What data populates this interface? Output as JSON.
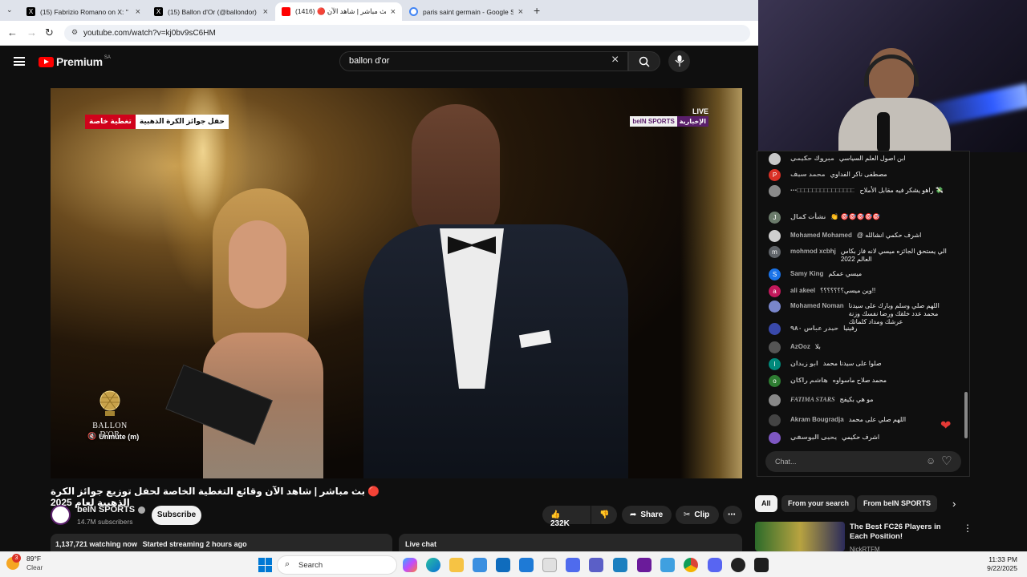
{
  "browser": {
    "tabs": [
      {
        "label": "(15) Fabrizio Romano on X: \"",
        "icon": "x-logo-icon",
        "active": false
      },
      {
        "label": "(15) Ballon d'Or (@ballondor) /",
        "icon": "x-logo-icon",
        "active": false
      },
      {
        "label": "بث مباشر | شاهد الآن 🔴 (1416)",
        "icon": "youtube-icon",
        "active": true
      },
      {
        "label": "paris saint germain - Google Se",
        "icon": "google-icon",
        "active": false
      }
    ],
    "url": "youtube.com/watch?v=kj0bv9sC6HM"
  },
  "youtube": {
    "logo_text": "Premium",
    "region": "SA",
    "search_value": "ballon d'or"
  },
  "video": {
    "overlay_left": "تغطية خاصة",
    "overlay_right": "حفل جوائز الكرة الذهبية",
    "live_badge": "LIVE",
    "channel_bug_en": "beIN SPORTS",
    "channel_bug_ar": "الإخبارية",
    "unmute_label": "Unmute (m)",
    "event_logo": "BALLON D'OR"
  },
  "video_info": {
    "title": "🔴 بث مباشر | شاهد الآن وقائع التغطية الخاصة لحفل توزيع جوائز الكرة الذهبية لعام 2025",
    "channel_name": "beIN SPORTS",
    "subscribers": "14.7M subscribers",
    "subscribe_label": "Subscribe",
    "likes": "232K",
    "share_label": "Share",
    "clip_label": "Clip",
    "watching": "1,137,721 watching now",
    "started": "Started streaming 2 hours ago",
    "live_chat_label": "Live chat"
  },
  "chat": {
    "messages": [
      {
        "author": "مبروك حكيمي",
        "text": "ابن اصول العلم السياسي",
        "color": "#c8c8c8",
        "initial": ""
      },
      {
        "author": "محمد سيف",
        "text": "مصطفى ناكر الفداوي",
        "color": "#d93025",
        "initial": "P"
      },
      {
        "author": "⋯□□□□□□□□□□□□□□□",
        "text": "راهو يشكر فيه مقابل الأملاح 💸",
        "color": "#8a8a8a",
        "initial": ""
      },
      {
        "author": "نشأت كمال",
        "text": "👏 🎯🎯🎯🎯🎯",
        "color": "#6b7b6b",
        "initial": "J"
      },
      {
        "author": "Mohamed Mohamed",
        "text": "@ اشرف حكمي انشالله",
        "color": "#cfcfcf",
        "initial": ""
      },
      {
        "author": "mohmod xcbhj",
        "text": "الي يستحق الجائزه ميسي لانه فاز بكاس العالم 2022",
        "color": "#5f6368",
        "initial": "m"
      },
      {
        "author": "Samy King",
        "text": "ميسي عمكم",
        "color": "#1a73e8",
        "initial": "S"
      },
      {
        "author": "ali akeel",
        "text": "وين ميسي؟؟؟؟؟؟؟!!",
        "color": "#c2185b",
        "initial": "a"
      },
      {
        "author": "Mohamed Noman",
        "text": "اللهم صلي وسلم وبارك على سيدنا محمد عدد خلقك ورضا نفسك وزنة عرشك ومداد كلماتك",
        "color": "#7986cb",
        "initial": ""
      },
      {
        "author": "حيدر عباس ٩٨٠",
        "text": "رفينيا",
        "color": "#3949ab",
        "initial": ""
      },
      {
        "author": "AzOoz",
        "text": "بلا",
        "color": "#555555",
        "initial": ""
      },
      {
        "author": "ابو زيدان",
        "text": "صلوا على سيدنا محمد",
        "color": "#00897b",
        "initial": "I"
      },
      {
        "author": "هاشم راكان",
        "text": "محمد صلاح ماسواوه",
        "color": "#2e7d32",
        "initial": "o"
      },
      {
        "author": "FATIMA STARS",
        "text": "مو هي بكيفج",
        "color": "#888888",
        "initial": ""
      },
      {
        "author": "Akram Bougradja",
        "text": "اللهم صلي على محمد",
        "color": "#444444",
        "initial": ""
      },
      {
        "author": "يحيى اليوسفي",
        "text": "اشرف حكيمي",
        "color": "#7e57c2",
        "initial": ""
      }
    ],
    "input_placeholder": "Chat..."
  },
  "chips": [
    "All",
    "From your search",
    "From beIN SPORTS"
  ],
  "recommendation": {
    "title": "The Best FC26 Players in Each Position!",
    "channel": "NickRTFM"
  },
  "taskbar": {
    "temperature": "89°F",
    "weather": "Clear",
    "weather_badge": "3",
    "search_label": "Search",
    "time": "11:33 PM",
    "date": "9/22/2025"
  }
}
